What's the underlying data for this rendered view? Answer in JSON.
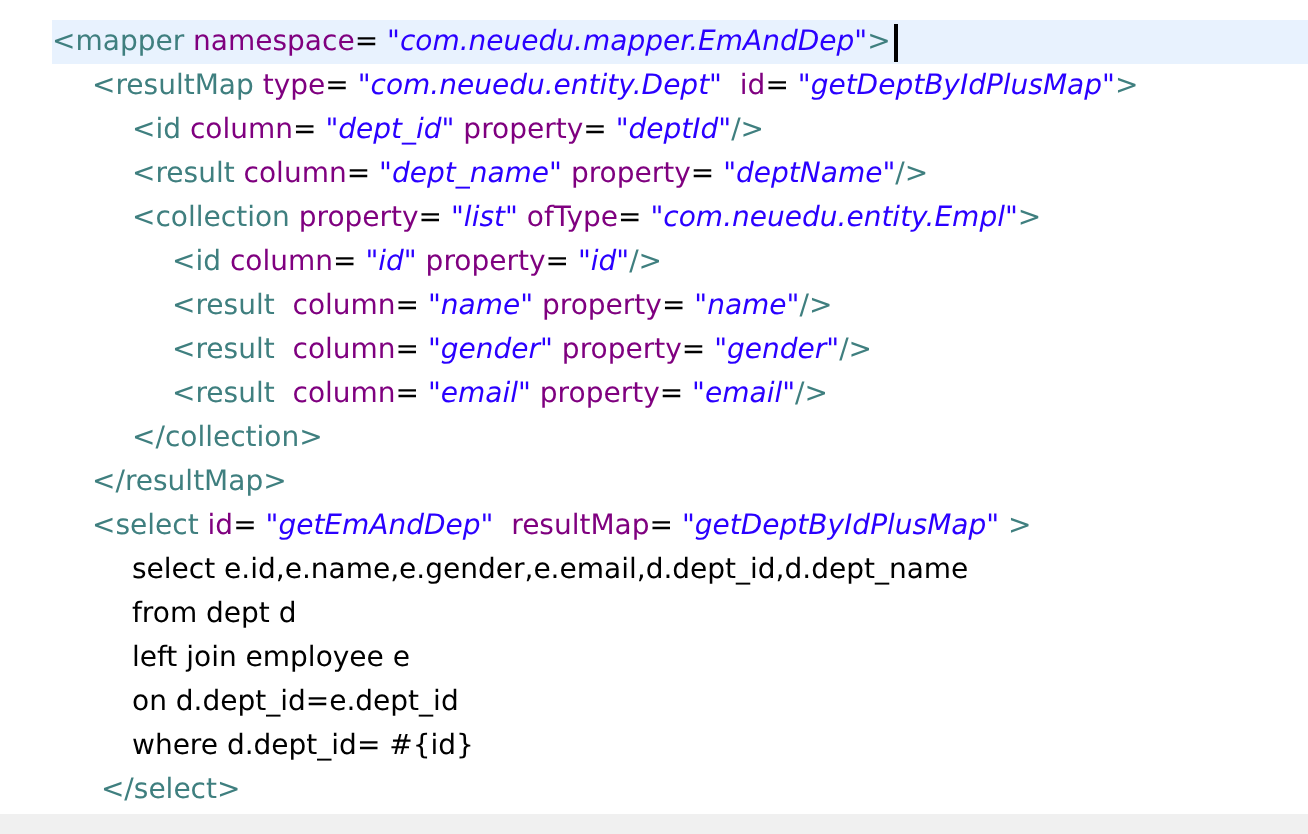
{
  "editor": {
    "lines": [
      {
        "selected": true,
        "tokens": [
          {
            "kind": "tag",
            "text": "<mapper"
          },
          {
            "kind": "attr",
            "text": " namespace"
          },
          {
            "kind": "eq",
            "text": "= "
          },
          {
            "kind": "value",
            "text": "\"com.neuedu.mapper.EmAndDep\""
          },
          {
            "kind": "tag",
            "text": ">"
          }
        ],
        "children": [
          {
            "selected": false,
            "tokens": [
              {
                "kind": "tag",
                "text": "<resultMap"
              },
              {
                "kind": "attr",
                "text": " type"
              },
              {
                "kind": "eq",
                "text": "= "
              },
              {
                "kind": "value",
                "text": "\"com.neuedu.entity.Dept\""
              },
              {
                "kind": "attr",
                "text": "  id"
              },
              {
                "kind": "eq",
                "text": "= "
              },
              {
                "kind": "value",
                "text": "\"getDeptByIdPlusMap\""
              },
              {
                "kind": "tag",
                "text": ">"
              }
            ],
            "children": [
              {
                "selected": false,
                "tokens": [
                  {
                    "kind": "tag",
                    "text": "<id"
                  },
                  {
                    "kind": "attr",
                    "text": " column"
                  },
                  {
                    "kind": "eq",
                    "text": "= "
                  },
                  {
                    "kind": "value",
                    "text": "\"dept_id\""
                  },
                  {
                    "kind": "attr",
                    "text": " property"
                  },
                  {
                    "kind": "eq",
                    "text": "= "
                  },
                  {
                    "kind": "value",
                    "text": "\"deptId\""
                  },
                  {
                    "kind": "tag",
                    "text": "/>"
                  }
                ]
              },
              {
                "selected": false,
                "tokens": [
                  {
                    "kind": "tag",
                    "text": "<result"
                  },
                  {
                    "kind": "attr",
                    "text": " column"
                  },
                  {
                    "kind": "eq",
                    "text": "= "
                  },
                  {
                    "kind": "value",
                    "text": "\"dept_name\""
                  },
                  {
                    "kind": "attr",
                    "text": " property"
                  },
                  {
                    "kind": "eq",
                    "text": "= "
                  },
                  {
                    "kind": "value",
                    "text": "\"deptName\""
                  },
                  {
                    "kind": "tag",
                    "text": "/>"
                  }
                ]
              },
              {
                "selected": false,
                "tokens": [
                  {
                    "kind": "tag",
                    "text": "<collection"
                  },
                  {
                    "kind": "attr",
                    "text": " property"
                  },
                  {
                    "kind": "eq",
                    "text": "= "
                  },
                  {
                    "kind": "value",
                    "text": "\"list\""
                  },
                  {
                    "kind": "attr",
                    "text": " ofType"
                  },
                  {
                    "kind": "eq",
                    "text": "= "
                  },
                  {
                    "kind": "value",
                    "text": "\"com.neuedu.entity.Empl\""
                  },
                  {
                    "kind": "tag",
                    "text": ">"
                  }
                ],
                "children": [
                  {
                    "selected": false,
                    "tokens": [
                      {
                        "kind": "tag",
                        "text": "<id"
                      },
                      {
                        "kind": "attr",
                        "text": " column"
                      },
                      {
                        "kind": "eq",
                        "text": "= "
                      },
                      {
                        "kind": "value",
                        "text": "\"id\""
                      },
                      {
                        "kind": "attr",
                        "text": " property"
                      },
                      {
                        "kind": "eq",
                        "text": "= "
                      },
                      {
                        "kind": "value",
                        "text": "\"id\""
                      },
                      {
                        "kind": "tag",
                        "text": "/>"
                      }
                    ]
                  },
                  {
                    "selected": false,
                    "tokens": [
                      {
                        "kind": "tag",
                        "text": "<result"
                      },
                      {
                        "kind": "attr",
                        "text": "  column"
                      },
                      {
                        "kind": "eq",
                        "text": "= "
                      },
                      {
                        "kind": "value",
                        "text": "\"name\""
                      },
                      {
                        "kind": "attr",
                        "text": " property"
                      },
                      {
                        "kind": "eq",
                        "text": "= "
                      },
                      {
                        "kind": "value",
                        "text": "\"name\""
                      },
                      {
                        "kind": "tag",
                        "text": "/>"
                      }
                    ]
                  },
                  {
                    "selected": false,
                    "tokens": [
                      {
                        "kind": "tag",
                        "text": "<result"
                      },
                      {
                        "kind": "attr",
                        "text": "  column"
                      },
                      {
                        "kind": "eq",
                        "text": "= "
                      },
                      {
                        "kind": "value",
                        "text": "\"gender\""
                      },
                      {
                        "kind": "attr",
                        "text": " property"
                      },
                      {
                        "kind": "eq",
                        "text": "= "
                      },
                      {
                        "kind": "value",
                        "text": "\"gender\""
                      },
                      {
                        "kind": "tag",
                        "text": "/>"
                      }
                    ]
                  },
                  {
                    "selected": false,
                    "tokens": [
                      {
                        "kind": "tag",
                        "text": "<result"
                      },
                      {
                        "kind": "attr",
                        "text": "  column"
                      },
                      {
                        "kind": "eq",
                        "text": "= "
                      },
                      {
                        "kind": "value",
                        "text": "\"email\""
                      },
                      {
                        "kind": "attr",
                        "text": " property"
                      },
                      {
                        "kind": "eq",
                        "text": "= "
                      },
                      {
                        "kind": "value",
                        "text": "\"email\""
                      },
                      {
                        "kind": "tag",
                        "text": "/>"
                      }
                    ]
                  }
                ]
              },
              {
                "selected": false,
                "tokens": [
                  {
                    "kind": "tag",
                    "text": "</collection>"
                  }
                ]
              }
            ]
          },
          {
            "selected": false,
            "tokens": [
              {
                "kind": "tag",
                "text": "</resultMap>"
              }
            ]
          },
          {
            "selected": false,
            "tokens": [
              {
                "kind": "tag",
                "text": "<select"
              },
              {
                "kind": "attr",
                "text": " id"
              },
              {
                "kind": "eq",
                "text": "= "
              },
              {
                "kind": "value",
                "text": "\"getEmAndDep\""
              },
              {
                "kind": "attr",
                "text": "  resultMap"
              },
              {
                "kind": "eq",
                "text": "= "
              },
              {
                "kind": "value",
                "text": "\"getDeptByIdPlusMap\""
              },
              {
                "kind": "tag",
                "text": " >"
              }
            ],
            "children": [
              {
                "selected": false,
                "tokens": [
                  {
                    "kind": "sql",
                    "text": "select e.id,e.name,e.gender,e.email,d.dept_id,d.dept_name"
                  }
                ]
              },
              {
                "selected": false,
                "tokens": [
                  {
                    "kind": "sql",
                    "text": "from dept d"
                  }
                ]
              },
              {
                "selected": false,
                "tokens": [
                  {
                    "kind": "sql",
                    "text": "left join employee e"
                  }
                ]
              },
              {
                "selected": false,
                "tokens": [
                  {
                    "kind": "sql",
                    "text": "on d.dept_id=e.dept_id"
                  }
                ]
              },
              {
                "selected": false,
                "tokens": [
                  {
                    "kind": "sql",
                    "text": "where d.dept_id= #{id}"
                  }
                ]
              }
            ]
          },
          {
            "selected": false,
            "tokens": [
              {
                "kind": "tag",
                "text": " </select>"
              }
            ]
          }
        ]
      }
    ]
  }
}
